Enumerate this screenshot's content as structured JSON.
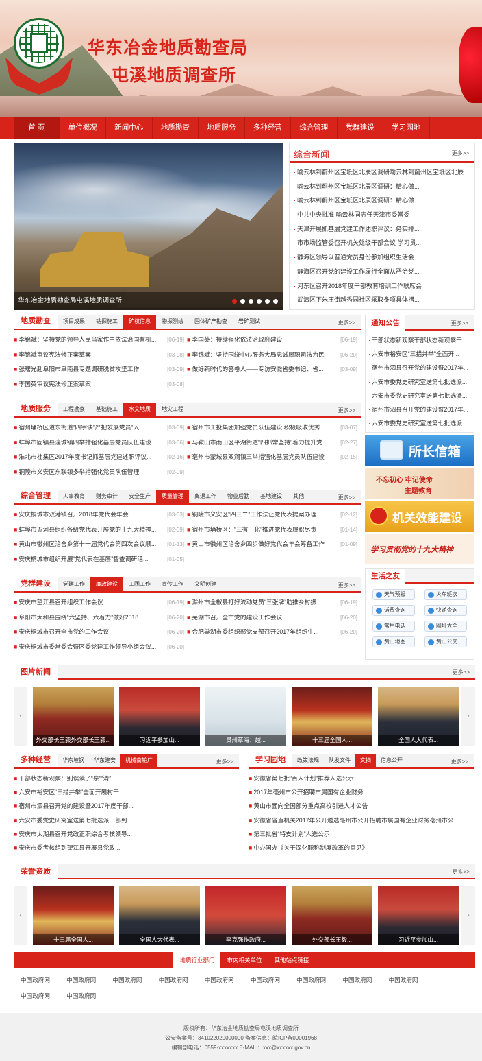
{
  "header": {
    "title_line1": "华东冶金地质勘查局",
    "title_line2": "屯溪地质调查所"
  },
  "nav": [
    "首 页",
    "单位概况",
    "新闻中心",
    "地质勘查",
    "地质服务",
    "多种经营",
    "综合管理",
    "党群建设",
    "学习园地"
  ],
  "slider": {
    "caption": "华东冶金地质勘查局屯溪地质调查所",
    "dot_count": 6,
    "active_dot": 0
  },
  "news": {
    "title": "综合新闻",
    "more": "更多>>",
    "items": [
      "喻云林到蓟州区宝坻区北辰区调研喻云林到蓟州区宝坻区北辰...",
      "喻云林到蓟州区宝坻区北辰区调研：精心做...",
      "喻云林到蓟州区宝坻区北辰区调研：精心做...",
      "中共中央批准 喻云林同志任天津市委常委",
      "天津开展抓基层党建工作述职评议：务实排...",
      "市市场监管委召开机关处级干部会议 学习贯...",
      "静海区领导以普通党员身份参加组织生活会",
      "静海区召开党的建设工作履行全面从严治党...",
      "河东区召开2018年度干部教育培训工作联席会",
      "武清区下朱庄街越秀园社区采取多项具体措..."
    ]
  },
  "geology": {
    "label": "地质勘查",
    "tabs": [
      "项目成果",
      "钻探施工",
      "矿权信息",
      "物探测绘",
      "固体矿产勘查",
      "岩矿测试"
    ],
    "active_tab": 2,
    "more": "更多>>",
    "items": [
      {
        "t": "李锦斌：坚持党的领导人民当家作主依法治国有机...",
        "d": "[06-19]"
      },
      {
        "t": "李国英：持续强化依法治政府建设",
        "d": "[06-19]"
      },
      {
        "t": "李锦斌审议宪法修正案草案",
        "d": "[03-08]"
      },
      {
        "t": "李锦斌：坚持围绕中心服务大局忠诚履职司法为民",
        "d": "[06-20]"
      },
      {
        "t": "张曙光赴阜阳市阜南县专题调研脱贫攻坚工作",
        "d": "[03-09]"
      },
      {
        "t": "做好新时代的答卷人——专访安徽省委书记、省...",
        "d": "[03-09]"
      },
      {
        "t": "李国英审议宪法修正案草案",
        "d": "[03-08]"
      }
    ]
  },
  "service": {
    "label": "地质服务",
    "tabs": [
      "工程勘察",
      "基础施工",
      "水文地质",
      "地灾工程"
    ],
    "active_tab": 2,
    "more": "更多>>",
    "items": [
      {
        "t": "宿州埇桥区道东街道“四字诀”严把发展党员“入...",
        "d": "[03-09]"
      },
      {
        "t": "宿州市工投集团加强党员队伍建设 积极吸收优秀...",
        "d": "[03-07]"
      },
      {
        "t": "蚌埠市固镇县濠城镇四举措强化基层党员队伍建设",
        "d": "[03-06]"
      },
      {
        "t": "马鞍山市雨山区平湖街道“四抓常坚持”着力提升党...",
        "d": "[02-27]"
      },
      {
        "t": "淮北市杜集区2017年度书记抓基层党建述职评议...",
        "d": "[02-16]"
      },
      {
        "t": "亳州市蒙城县双涧镇三举措强化基层党员队伍建设",
        "d": "[02-15]"
      },
      {
        "t": "铜陵市义安区东联镇多举措强化党员队伍管理",
        "d": "[02-09]"
      }
    ]
  },
  "management": {
    "label": "综合管理",
    "tabs": [
      "人事教育",
      "财务审计",
      "安全生产",
      "质量管理",
      "离退工作",
      "物业后勤",
      "基地建设",
      "其他"
    ],
    "active_tab": 3,
    "more": "更多>>",
    "items": [
      {
        "t": "安庆桐城市双港镇召开2018年党代会年会",
        "d": "[03-03]"
      },
      {
        "t": "铜陵市义安区“四三二”工作法让党代表提案办理...",
        "d": "[02-12]"
      },
      {
        "t": "蚌埠市五河县组织各级党代表开展党的十九大精神...",
        "d": "[02-09]"
      },
      {
        "t": "宿州市埇桥区：“三有一化”推进党代表履职尽责",
        "d": "[01-14]"
      },
      {
        "t": "黄山市徽州区洽舍乡第十一届党代会第四次会议顺...",
        "d": "[01-13]"
      },
      {
        "t": "黄山市徽州区洽舍乡四步做好党代会年会筹备工作",
        "d": "[01-09]"
      },
      {
        "t": "安庆桐城市组织开展“党代表在基层”督查调研活...",
        "d": "[01-05]"
      }
    ]
  },
  "party": {
    "label": "党群建设",
    "tabs": [
      "党建工作",
      "廉政建设",
      "工团工作",
      "宣传工作",
      "文明创建"
    ],
    "active_tab": 1,
    "more": "更多>>",
    "items": [
      {
        "t": "安庆市望江县召开组织工作会议",
        "d": "[06-19]"
      },
      {
        "t": "滁州市全椒县打好流动党员“三张牌”助推乡村振...",
        "d": "[06-19]"
      },
      {
        "t": "阜阳市太和县围绕“六坚持、六着力”做好2018...",
        "d": "[06-20]"
      },
      {
        "t": "芜湖市召开全市党的建设工作会议",
        "d": "[06-20]"
      },
      {
        "t": "安庆桐城市召开全市党的工作会议",
        "d": "[06-20]"
      },
      {
        "t": "合肥巢湖市委组织部党支部召开2017年组织生...",
        "d": "[06-20]"
      },
      {
        "t": "安庆桐城市委常委会暨区委党建工作领导小组会议...",
        "d": "[06-20]"
      }
    ]
  },
  "notice": {
    "label": "通知公告",
    "more": "更多>>",
    "items": [
      "干部状态新观察干部状态新观察干...",
      "六安市裕安区“三措并举”全面开...",
      "宿州市泗县召开党的建设暨2017年...",
      "六安市委党史研究室送第七批选派...",
      "六安市委党史研究室送第七批选派...",
      "宿州市泗县召开党的建设暨2017年...",
      "六安市委党史研究室送第七批选派..."
    ]
  },
  "promos": [
    "所长信箱",
    "不忘初心  牢记使命",
    "主题教育",
    "机关效能建设",
    "学习贯彻党的十九大精神"
  ],
  "life": {
    "label": "生活之友",
    "items": [
      "天气预报",
      "火车班次",
      "话费查询",
      "快递查询",
      "常用电话",
      "网址大全",
      "黄山地图",
      "黄山公交"
    ]
  },
  "photo_news": {
    "label": "图片新闻",
    "more": "更多>>",
    "items": [
      "外交部长王毅外交部长王毅...",
      "习近平参加山...",
      "贵州草海：越...",
      "十三届全国人...",
      "全国人大代表..."
    ]
  },
  "business": {
    "label": "多种经营",
    "tabs": [
      "华东坡钢",
      "华东建安",
      "机械南轮厂"
    ],
    "active_tab": 2,
    "more": "更多>>",
    "items": [
      "干部状态新观察：别误读了“亲”“清”...",
      "六安市裕安区“三措并举”全面开展村干...",
      "宿州市泗县召开党的建设暨2017年度干部...",
      "六安市委党史研究室送第七批选派干部到...",
      "安庆市太湖县召开党政正职综合考核领导...",
      "安庆市委考核组到望江县开展县党政..."
    ]
  },
  "study": {
    "label": "学习园地",
    "tabs": [
      "政策法规",
      "队发文件",
      "文摘",
      "信息公开"
    ],
    "active_tab": 2,
    "more": "更多>>",
    "items": [
      "安徽省第七批“百人计划”推荐人选公示",
      "2017年亳州市公开招聘市属国有企业财务...",
      "黄山市面向全国部分重点高校引进人才公告",
      "安徽省省直机关2017年公开遴选亳州市公开招聘市属国有企业财务亳州市公...",
      "第三批省“特支计划”人选公示",
      "中办国办《关于深化职称制度改革的意见》"
    ]
  },
  "honor": {
    "label": "荣誉资质",
    "more": "更多>>",
    "items": [
      "十三届全国人...",
      "全国人大代表...",
      "李克强作政府...",
      "外交部长王毅...",
      "习近平参加山..."
    ]
  },
  "links": {
    "tabs": [
      "地质行业部门",
      "市内相关单位",
      "其他站点链接"
    ],
    "active_tab": 0,
    "items": [
      "中国政府网",
      "中国政府网",
      "中国政府网",
      "中国政府网",
      "中国政府网",
      "中国政府网",
      "中国政府网",
      "中国政府网",
      "中国政府网",
      "中国政府网",
      "中国政府网"
    ]
  },
  "footer": {
    "line1": "版权所有：华东冶金地质勘查局屯溪地质调查所",
    "line2": "公安备案号：341022020000000 备案信息：皖ICP备09001968",
    "line3": "编辑部电话：0559-xxxxxxx E-MAIL：xxx@xxxxxx.gov.cn"
  },
  "colors": {
    "brand": "#d8231a"
  }
}
